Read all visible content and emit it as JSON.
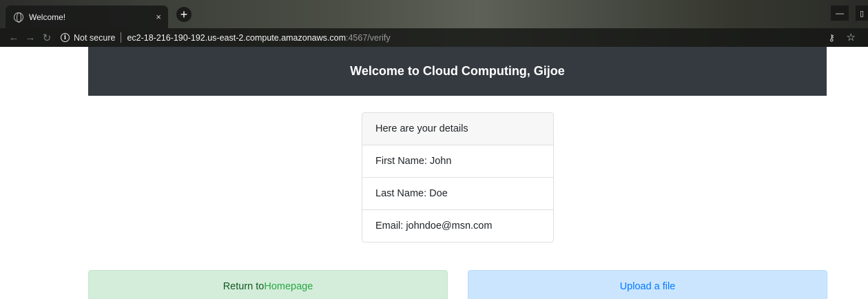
{
  "browser": {
    "tab_title": "Welcome!",
    "tab_close": "×",
    "new_tab": "+",
    "security_label": "Not secure",
    "url_host": "ec2-18-216-190-192.us-east-2.compute.amazonaws.com",
    "url_rest": ":4567/verify",
    "minimize": "—",
    "icons": {
      "back": "back-arrow-icon",
      "forward": "forward-arrow-icon",
      "reload": "reload-icon",
      "info": "info-icon",
      "key": "key-icon",
      "star": "star-icon",
      "favicon": "globe-icon"
    }
  },
  "header": {
    "title": "Welcome to Cloud Computing, Gijoe",
    "background": "#343a40"
  },
  "details": {
    "heading": "Here are your details",
    "first_name": "First Name: John",
    "last_name": "Last Name: Doe",
    "email": "Email: johndoe@msn.com"
  },
  "actions": {
    "return_prefix": "Return to ",
    "return_link": "Homepage",
    "upload": "Upload a file"
  },
  "colors": {
    "success_bg": "#d4edda",
    "success_link": "#28a745",
    "info_bg": "#cce5ff",
    "info_link": "#007bff"
  }
}
